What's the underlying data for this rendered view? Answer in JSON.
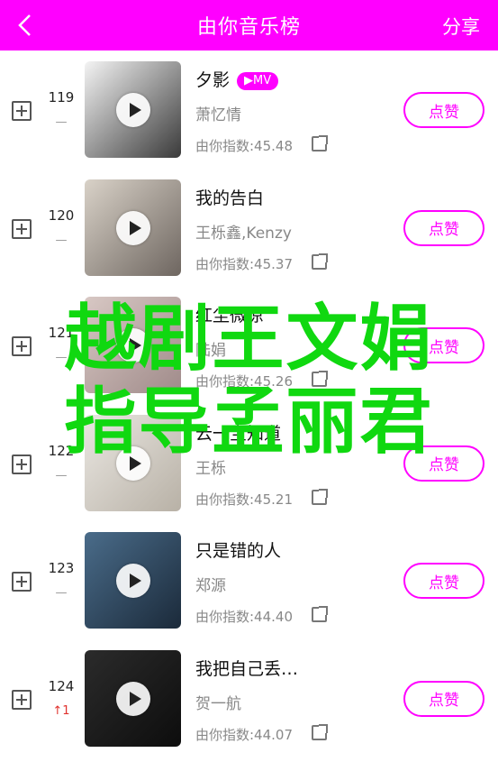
{
  "header": {
    "back_icon": "chevron-left-icon",
    "title": "由你音乐榜",
    "share_label": "分享"
  },
  "rows": [
    {
      "song": "夕影",
      "mv": "▶MV",
      "singer": "萧忆情",
      "index": "由你指数:45.48",
      "rank": "119",
      "trend": "—",
      "like": "点赞",
      "cover_colors": [
        "#f4f4f4",
        "#3a3a3a"
      ]
    },
    {
      "song": "我的告白",
      "singer": "王栎鑫,Kenzy",
      "index": "由你指数:45.37",
      "rank": "120",
      "trend": "—",
      "like": "点赞",
      "cover_colors": [
        "#d9d2c8",
        "#6e6660"
      ]
    },
    {
      "song": "红尘微凉",
      "singer": "陆娟",
      "index": "由你指数:45.26",
      "rank": "121",
      "trend": "—",
      "like": "点赞",
      "cover_colors": [
        "#d8c8c4",
        "#a08b8a"
      ]
    },
    {
      "song": "云一宝知道",
      "singer": "王栎",
      "index": "由你指数:45.21",
      "rank": "122",
      "trend": "—",
      "like": "点赞",
      "cover_colors": [
        "#eae7e2",
        "#b8b1a6"
      ]
    },
    {
      "song": "只是错的人",
      "singer": "郑源",
      "index": "由你指数:44.40",
      "rank": "123",
      "trend": "—",
      "like": "点赞",
      "cover_colors": [
        "#4a6c8a",
        "#1b2a3a"
      ]
    },
    {
      "song": "我把自己丢…",
      "singer": "贺一航",
      "index": "由你指数:44.07",
      "rank": "124",
      "trend": "↑1",
      "like": "点赞",
      "cover_colors": [
        "#2b2b2b",
        "#0d0d0d"
      ]
    }
  ],
  "watermark": {
    "line1": "越剧王文娟",
    "line2": "指导孟丽君",
    "color": "#10d810"
  },
  "colors": {
    "accent": "#ff00ff",
    "trend_up": "#e0312d"
  }
}
